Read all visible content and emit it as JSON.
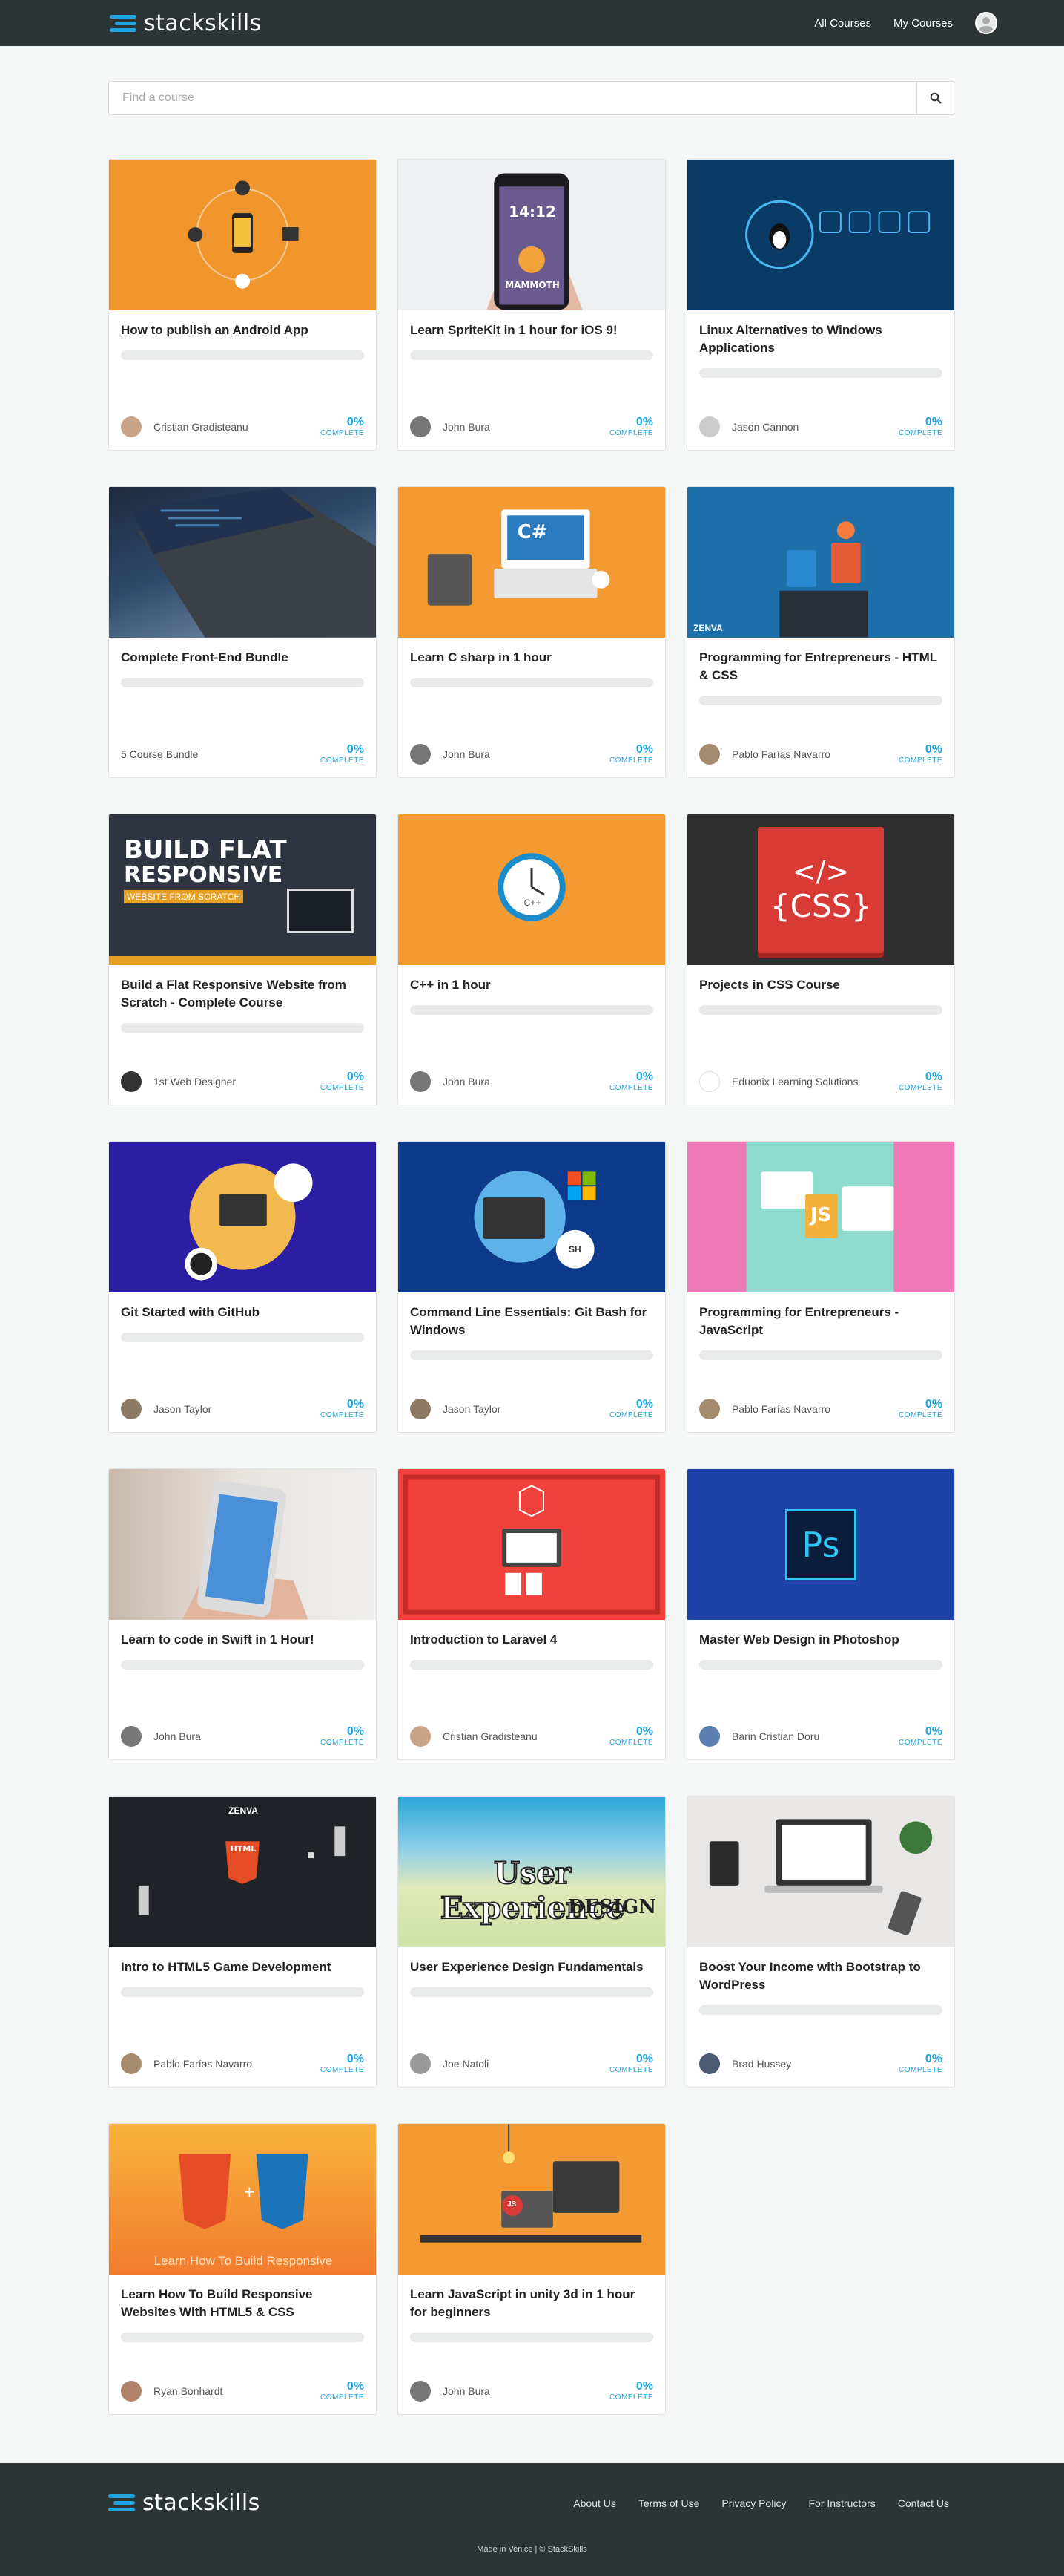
{
  "header": {
    "brand": "stackskills",
    "nav": [
      "All Courses",
      "My Courses"
    ]
  },
  "search": {
    "placeholder": "Find a course"
  },
  "colors": {
    "accent": "#1fa6e0",
    "header_bg": "#2d3436"
  },
  "courses": [
    {
      "title": "How to publish an Android App",
      "author": "Cristian Gradisteanu",
      "progress": "0%",
      "progress_label": "COMPLETE",
      "thumb_text": ""
    },
    {
      "title": "Learn SpriteKit in 1 hour for iOS 9!",
      "author": "John Bura",
      "progress": "0%",
      "progress_label": "COMPLETE",
      "thumb_text": "14:12",
      "thumb_text2": "MAMMOTH"
    },
    {
      "title": "Linux Alternatives to Windows Applications",
      "author": "Jason Cannon",
      "progress": "0%",
      "progress_label": "COMPLETE",
      "thumb_text": ""
    },
    {
      "title": "Complete Front-End Bundle",
      "author": "5 Course Bundle",
      "progress": "0%",
      "progress_label": "COMPLETE",
      "thumb_text": ""
    },
    {
      "title": "Learn C sharp in 1 hour",
      "author": "John Bura",
      "progress": "0%",
      "progress_label": "COMPLETE",
      "thumb_text": "C#"
    },
    {
      "title": "Programming for Entrepreneurs - HTML & CSS",
      "author": "Pablo Farías Navarro",
      "progress": "0%",
      "progress_label": "COMPLETE",
      "thumb_text": "ZENVA"
    },
    {
      "title": "Build a Flat Responsive Website from Scratch - Complete Course",
      "author": "1st Web Designer",
      "progress": "0%",
      "progress_label": "COMPLETE",
      "thumb_text": "BUILD FLAT",
      "thumb_text2": "RESPONSIVE",
      "thumb_text3": "WEBSITE FROM SCRATCH"
    },
    {
      "title": "C++ in 1 hour",
      "author": "John Bura",
      "progress": "0%",
      "progress_label": "COMPLETE",
      "thumb_text": "C++"
    },
    {
      "title": "Projects in CSS Course",
      "author": "Eduonix Learning Solutions",
      "progress": "0%",
      "progress_label": "COMPLETE",
      "thumb_text": "</>",
      "thumb_text2": "{CSS}"
    },
    {
      "title": "Git Started with GitHub",
      "author": "Jason Taylor",
      "progress": "0%",
      "progress_label": "COMPLETE",
      "thumb_text": ""
    },
    {
      "title": "Command Line Essentials: Git Bash for Windows",
      "author": "Jason Taylor",
      "progress": "0%",
      "progress_label": "COMPLETE",
      "thumb_text": "SH"
    },
    {
      "title": "Programming for Entrepreneurs - JavaScript",
      "author": "Pablo Farías Navarro",
      "progress": "0%",
      "progress_label": "COMPLETE",
      "thumb_text": "JS"
    },
    {
      "title": "Learn to code in Swift in 1 Hour!",
      "author": "John Bura",
      "progress": "0%",
      "progress_label": "COMPLETE",
      "thumb_text": ""
    },
    {
      "title": "Introduction to Laravel 4",
      "author": "Cristian Gradisteanu",
      "progress": "0%",
      "progress_label": "COMPLETE",
      "thumb_text": ""
    },
    {
      "title": "Master Web Design in Photoshop",
      "author": "Barin Cristian Doru",
      "progress": "0%",
      "progress_label": "COMPLETE",
      "thumb_text": "Ps"
    },
    {
      "title": "Intro to HTML5 Game Development",
      "author": "Pablo Farías Navarro",
      "progress": "0%",
      "progress_label": "COMPLETE",
      "thumb_text": "ZENVA",
      "thumb_text2": "HTML"
    },
    {
      "title": "User Experience Design Fundamentals",
      "author": "Joe Natoli",
      "progress": "0%",
      "progress_label": "COMPLETE",
      "thumb_text": "User Experience",
      "thumb_text2": "DESIGN"
    },
    {
      "title": "Boost Your Income with Bootstrap to WordPress",
      "author": "Brad Hussey",
      "progress": "0%",
      "progress_label": "COMPLETE",
      "thumb_text": ""
    },
    {
      "title": "Learn How To Build Responsive Websites With HTML5 & CSS",
      "author": "Ryan Bonhardt",
      "progress": "0%",
      "progress_label": "COMPLETE",
      "thumb_text": "Learn How To Build Responsive"
    },
    {
      "title": "Learn JavaScript in unity 3d in 1 hour for beginners",
      "author": "John Bura",
      "progress": "0%",
      "progress_label": "COMPLETE",
      "thumb_text": "JS"
    }
  ],
  "footer": {
    "brand": "stackskills",
    "links": [
      "About Us",
      "Terms of Use",
      "Privacy Policy",
      "For Instructors",
      "Contact Us"
    ],
    "credits": "Made in Venice  |  © StackSkills"
  }
}
